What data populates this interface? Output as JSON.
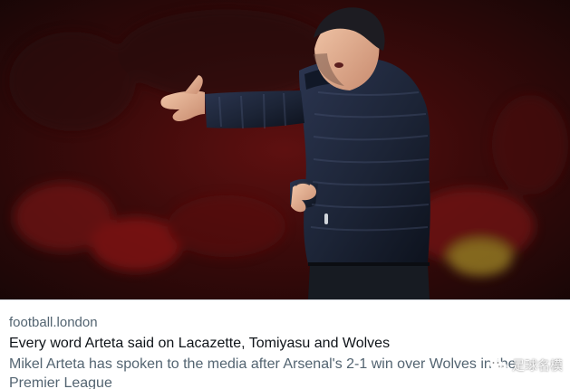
{
  "card": {
    "source": "football.london",
    "title": "Every word Arteta said on Lacazette, Tomiyasu and Wolves",
    "description": "Mikel Arteta has spoken to the media after Arsenal's 2-1 win over Wolves in the Premier League"
  },
  "watermark": {
    "icon": "wechat-icon",
    "text": "足球名模"
  },
  "colors": {
    "meta_text": "#536471",
    "title_text": "#0f1419",
    "image_bg": "#120707",
    "jacket": "#1c2436"
  }
}
